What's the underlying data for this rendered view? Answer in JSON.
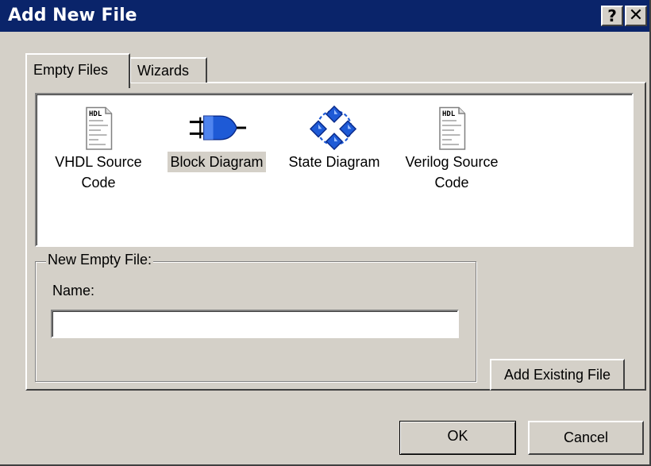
{
  "window": {
    "title": "Add New File",
    "help_glyph": "?",
    "close_glyph": "✕"
  },
  "tabs": [
    {
      "label": "Empty Files",
      "active": true
    },
    {
      "label": "Wizards",
      "active": false
    }
  ],
  "file_types": [
    {
      "line1": "VHDL Source",
      "line2": "Code",
      "icon": "hdl-document-icon"
    },
    {
      "line1": "Block Diagram",
      "line2": "",
      "icon": "block-diagram-icon",
      "selected": true
    },
    {
      "line1": "State Diagram",
      "line2": "",
      "icon": "state-diagram-icon"
    },
    {
      "line1": "Verilog Source",
      "line2": "Code",
      "icon": "hdl-document-icon"
    }
  ],
  "new_empty_file": {
    "group_label": "New Empty File:",
    "name_label": "Name:",
    "name_value": ""
  },
  "buttons": {
    "add_existing": "Add Existing File",
    "ok": "OK",
    "cancel": "Cancel"
  },
  "colors": {
    "titlebar": "#0a246a",
    "face": "#d4d0c8",
    "icon_blue": "#1e5ad6"
  },
  "icon_text": {
    "hdl": "HDL"
  }
}
